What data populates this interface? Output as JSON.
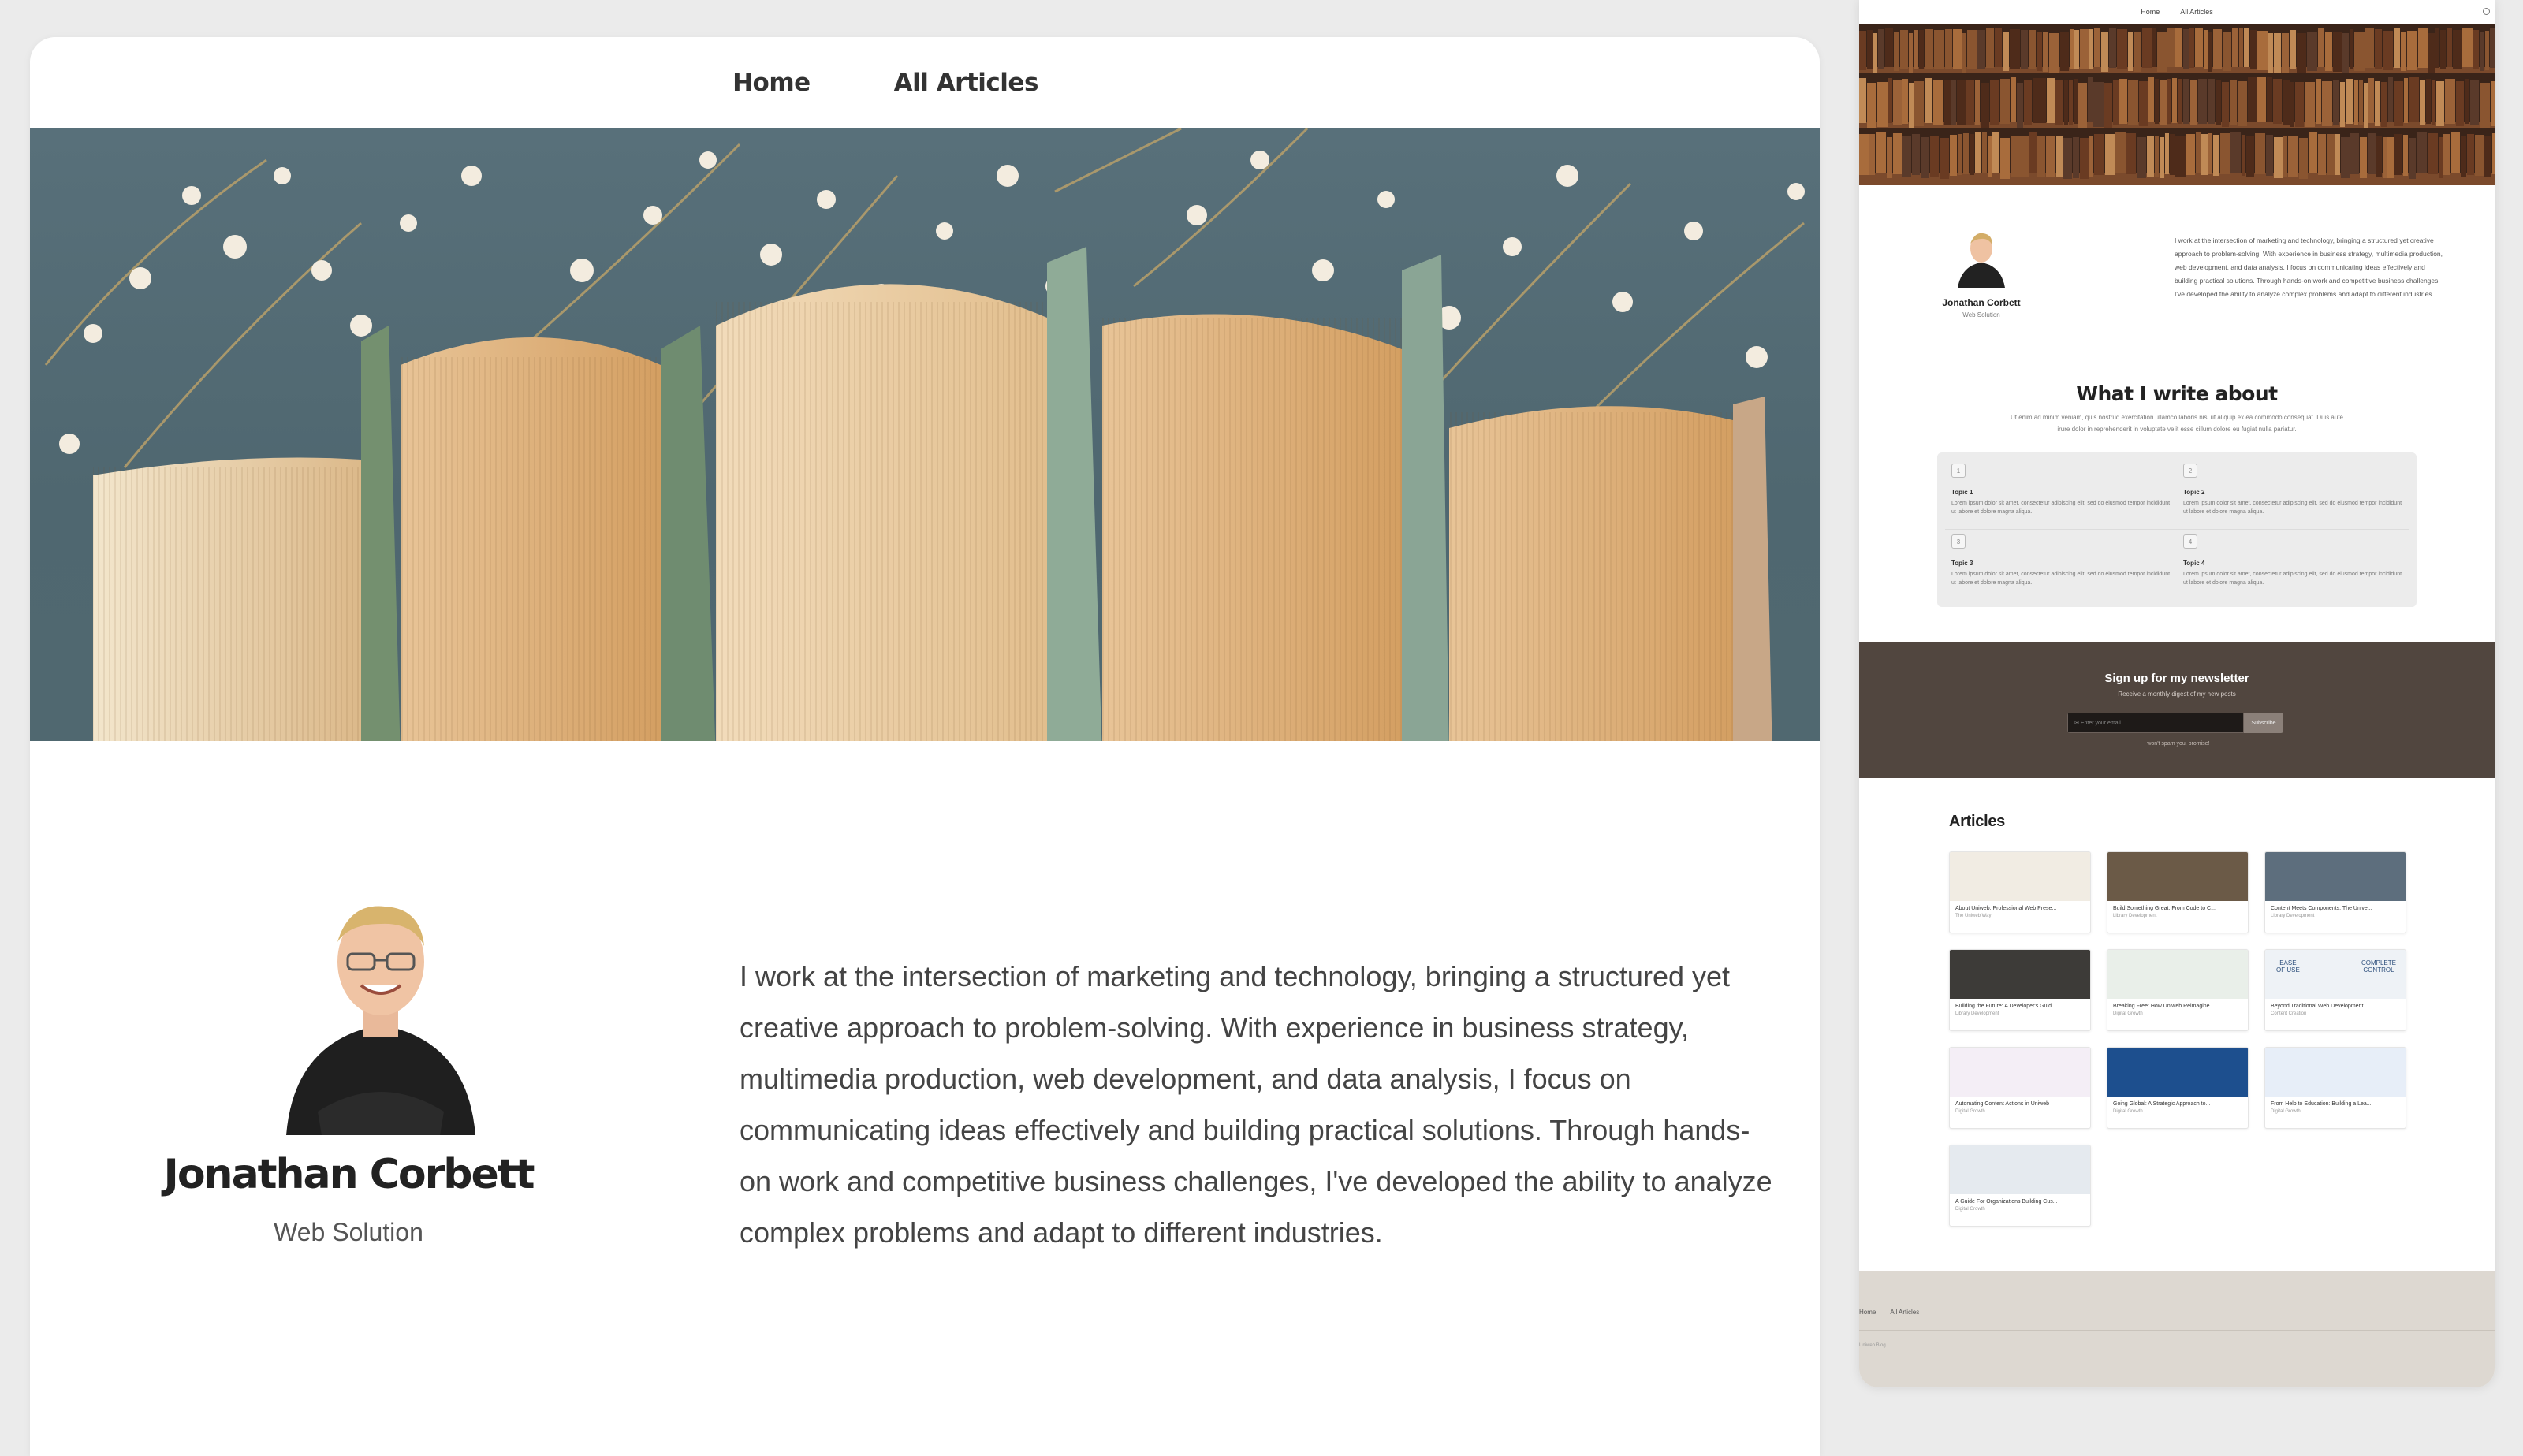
{
  "nav": {
    "home": "Home",
    "articles": "All Articles"
  },
  "author": {
    "name": "Jonathan Corbett",
    "role": "Web Solution",
    "bio": "I work at the intersection of marketing and technology, bringing a structured yet creative approach to problem-solving. With experience in business strategy, multimedia production, web development, and data analysis, I focus on communicating ideas effectively and building practical solutions. Through hands-on work and competitive business challenges, I've developed the ability to analyze complex problems and adapt to different industries."
  },
  "preview": {
    "nav": {
      "home": "Home",
      "articles": "All Articles"
    },
    "author": {
      "name": "Jonathan Corbett",
      "role": "Web Solution",
      "bio": "I work at the intersection of marketing and technology, bringing a structured yet creative approach to problem-solving. With experience in business strategy, multimedia production, web development, and data analysis, I focus on communicating ideas effectively and building practical solutions. Through hands-on work and competitive business challenges, I've developed the ability to analyze complex problems and adapt to different industries."
    },
    "write": {
      "title": "What I write about",
      "subtitle": "Ut enim ad minim veniam, quis nostrud exercitation ullamco laboris nisi ut aliquip ex ea commodo consequat. Duis aute irure dolor in reprehenderit in voluptate velit esse cillum dolore eu fugiat nulla pariatur."
    },
    "topics": [
      {
        "num": "1",
        "title": "Topic 1",
        "text": "Lorem ipsum dolor sit amet, consectetur adipiscing elit, sed do eiusmod tempor incididunt ut labore et dolore magna aliqua."
      },
      {
        "num": "2",
        "title": "Topic 2",
        "text": "Lorem ipsum dolor sit amet, consectetur adipiscing elit, sed do eiusmod tempor incididunt ut labore et dolore magna aliqua."
      },
      {
        "num": "3",
        "title": "Topic 3",
        "text": "Lorem ipsum dolor sit amet, consectetur adipiscing elit, sed do eiusmod tempor incididunt ut labore et dolore magna aliqua."
      },
      {
        "num": "4",
        "title": "Topic 4",
        "text": "Lorem ipsum dolor sit amet, consectetur adipiscing elit, sed do eiusmod tempor incididunt ut labore et dolore magna aliqua."
      }
    ],
    "newsletter": {
      "title": "Sign up for my newsletter",
      "subtitle": "Receive a monthly digest of my new posts",
      "placeholder": "Enter your email",
      "button": "Subscribe",
      "note": "I won't spam you, promise!"
    },
    "articles_title": "Articles",
    "articles": [
      {
        "title": "About Uniweb: Professional Web Prese...",
        "category": "The Uniweb Way",
        "color": "#f1ece3"
      },
      {
        "title": "Build Something Great: From Code to C...",
        "category": "Library Development",
        "color": "#6b5a47"
      },
      {
        "title": "Content Meets Components: The Unive...",
        "category": "Library Development",
        "color": "#5d6e7d"
      },
      {
        "title": "Building the Future: A Developer's Guid...",
        "category": "Library Development",
        "color": "#3d3b38"
      },
      {
        "title": "Breaking Free: How Uniweb Reimagine...",
        "category": "Digital Growth",
        "color": "#e9efe9"
      },
      {
        "title": "Beyond Traditional Web Development",
        "category": "Content Creation",
        "color": "#eef2f6"
      },
      {
        "title": "Automating Content Actions in Uniweb",
        "category": "Digital Growth",
        "color": "#f4eef6"
      },
      {
        "title": "Going Global: A Strategic Approach to...",
        "category": "Digital Growth",
        "color": "#1d4f8e"
      },
      {
        "title": "From Help to Education: Building a Lea...",
        "category": "Digital Growth",
        "color": "#e7eef8"
      },
      {
        "title": "A Guide For Organizations Building Cus...",
        "category": "Digital Growth",
        "color": "#e5eaef"
      }
    ],
    "ease_label_1": "EASE",
    "ease_label_2": "OF USE",
    "control_label_1": "COMPLETE",
    "control_label_2": "CONTROL",
    "footer": {
      "home": "Home",
      "articles": "All Articles",
      "copy": "Uniweb Blog"
    }
  },
  "colors": {
    "page_bg": "#ebebeb",
    "newsletter_bg": "#51463f",
    "footer_bg": "#ddd8d1",
    "hero_bg": "#536b74"
  }
}
